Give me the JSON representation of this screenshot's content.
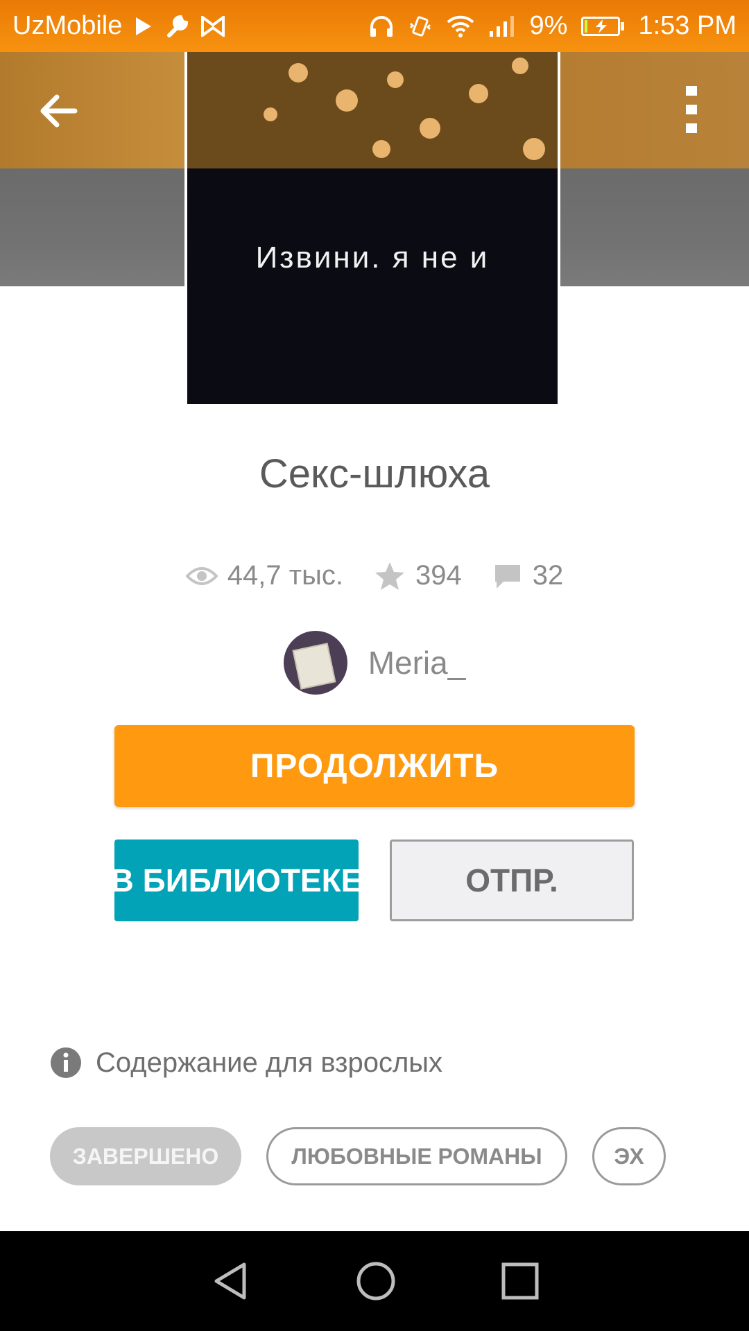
{
  "status_bar": {
    "carrier": "UzMobile",
    "battery_percent": "9%",
    "battery_level": 0.09,
    "time": "1:53 PM",
    "icons": [
      "play-icon",
      "wrench-icon",
      "bowtie-icon",
      "headphones-icon",
      "vibrate-icon",
      "wifi-icon",
      "signal-icon",
      "battery-charging-icon"
    ]
  },
  "toolbar": {
    "back_icon": "arrow-left-icon",
    "menu_icon": "more-vertical-icon"
  },
  "cover": {
    "caption": "Извини. я не и"
  },
  "story": {
    "title": "Секс-шлюха",
    "views": "44,7 тыс.",
    "votes": "394",
    "comments": "32",
    "author": "Meria_"
  },
  "actions": {
    "continue_label": "ПРОДОЛЖИТЬ",
    "library_label": "В БИБЛИОТЕКЕ",
    "send_label": "ОТПР."
  },
  "info": {
    "adult_label": "Содержание для взрослых"
  },
  "tags": [
    {
      "label": "ЗАВЕРШЕНО"
    },
    {
      "label": "ЛЮБОВНЫЕ РОМАНЫ"
    },
    {
      "label": "ЭХ"
    }
  ],
  "colors": {
    "accent": "#ff9a10",
    "library": "#03a3b7",
    "status_bar": "#f7920f"
  }
}
